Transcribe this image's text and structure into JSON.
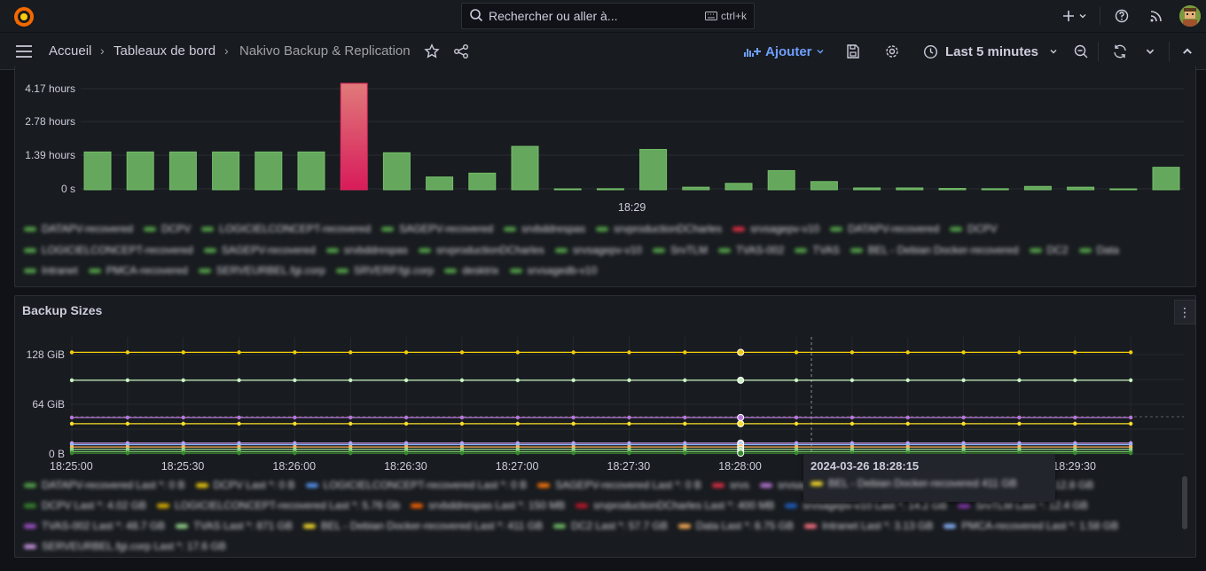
{
  "topbar": {
    "search_placeholder": "Rechercher ou aller à...",
    "search_shortcut": "ctrl+k"
  },
  "breadcrumb": {
    "home": "Accueil",
    "dashboards": "Tableaux de bord",
    "current": "Nakivo Backup & Replication"
  },
  "toolbar": {
    "add_label": "Ajouter",
    "time_range": "Last 5 minutes"
  },
  "panel1": {
    "y_ticks": [
      "4.17 hours",
      "2.78 hours",
      "1.39 hours",
      "0 s"
    ],
    "x_label": "18:29",
    "legend": [
      {
        "name": "DATAPV-recovered",
        "color": "#56a64b"
      },
      {
        "name": "DCPV",
        "color": "#56a64b"
      },
      {
        "name": "LOGICIELCONCEPT-recovered",
        "color": "#56a64b"
      },
      {
        "name": "SAGEPV-recovered",
        "color": "#56a64b"
      },
      {
        "name": "srvbddrespas",
        "color": "#56a64b"
      },
      {
        "name": "srvproductionDCharles",
        "color": "#56a64b"
      },
      {
        "name": "srvsagepv-v10",
        "color": "#e02f44"
      },
      {
        "name": "DATAPV-recovered",
        "color": "#56a64b"
      },
      {
        "name": "DCPV",
        "color": "#56a64b"
      },
      {
        "name": "LOGICIELCONCEPT-recovered",
        "color": "#56a64b"
      },
      {
        "name": "SAGEPV-recovered",
        "color": "#56a64b"
      },
      {
        "name": "srvbddrespas",
        "color": "#56a64b"
      },
      {
        "name": "srvproductionDCharles",
        "color": "#56a64b"
      },
      {
        "name": "srvsagepv-v10",
        "color": "#56a64b"
      },
      {
        "name": "SrvTLM",
        "color": "#56a64b"
      },
      {
        "name": "TVAS-002",
        "color": "#56a64b"
      },
      {
        "name": "TVAS",
        "color": "#56a64b"
      },
      {
        "name": "BEL - Debian Docker-recovered",
        "color": "#56a64b"
      },
      {
        "name": "DC2",
        "color": "#56a64b"
      },
      {
        "name": "Data",
        "color": "#56a64b"
      },
      {
        "name": "Intranet",
        "color": "#56a64b"
      },
      {
        "name": "PMCA-recovered",
        "color": "#56a64b"
      },
      {
        "name": "SERVEURBEL.fgi.corp",
        "color": "#56a64b"
      },
      {
        "name": "SRVERP.fgi.corp",
        "color": "#56a64b"
      },
      {
        "name": "desktrix",
        "color": "#56a64b"
      },
      {
        "name": "srvsagedb-v10",
        "color": "#56a64b"
      }
    ]
  },
  "panel2": {
    "title": "Backup Sizes",
    "y_ticks": [
      "128 GiB",
      "64 GiB",
      "0 B"
    ],
    "x_ticks": [
      "18:25:00",
      "18:25:30",
      "18:26:00",
      "18:26:30",
      "18:27:00",
      "18:27:30",
      "18:28:00",
      "18:28:30",
      "18:29:00",
      "18:29:30"
    ],
    "tooltip_time": "2024-03-26 18:28:15",
    "legend": [
      {
        "name": "DATAPV-recovered  Last *: 0 B",
        "color": "#56a64b"
      },
      {
        "name": "DCPV  Last *: 0 B",
        "color": "#f2cc0c"
      },
      {
        "name": "LOGICIELCONCEPT-recovered  Last *: 0 B",
        "color": "#5794f2"
      },
      {
        "name": "SAGEPV-recovered  Last *: 0 B",
        "color": "#ff780a"
      },
      {
        "name": "srvs",
        "color": "#e02f44"
      },
      {
        "name": "srvsagepv-v10  Last *: 0 B",
        "color": "#b877d9"
      },
      {
        "name": "DATAPV-recovered  Last *: 12.8 GB",
        "color": "#8f3bb8"
      },
      {
        "name": "DCPV  Last *: 4.02 GB",
        "color": "#37872d"
      },
      {
        "name": "LOGICIELCONCEPT-recovered  Last *: 5.76 Gb",
        "color": "#e0b400"
      },
      {
        "name": "srvbddrespas  Last *: 150 MB",
        "color": "#fa6400"
      },
      {
        "name": "srvproductionDCharles  Last *: 400 MB",
        "color": "#c4162a"
      },
      {
        "name": "srvsagepv-v10  Last *: 14.2 GB",
        "color": "#1f60c4"
      },
      {
        "name": "SrvTLM  Last *: 12.4 GB",
        "color": "#8f3bb8"
      },
      {
        "name": "TVAS-002  Last *: 48.7 GB",
        "color": "#a352cc"
      },
      {
        "name": "TVAS  Last *: 871 GB",
        "color": "#96d98d"
      },
      {
        "name": "BEL - Debian Docker-recovered  Last *: 411 GB",
        "color": "#fade2a"
      },
      {
        "name": "DC2  Last *: 57.7 GB",
        "color": "#73bf69"
      },
      {
        "name": "Data  Last *: 8.75 GB",
        "color": "#ffb357"
      },
      {
        "name": "Intranet  Last *: 3.13 GB",
        "color": "#ff7383"
      },
      {
        "name": "PMCA-recovered  Last *: 1.58 GB",
        "color": "#8ab8ff"
      },
      {
        "name": "SERVEURBEL.fgi.corp  Last *: 17.6 GB",
        "color": "#ca95e5"
      }
    ],
    "tooltip_row": "BEL - Debian Docker-recovered   411 GB"
  },
  "chart_data": [
    {
      "type": "bar",
      "title": "",
      "ylabel": "",
      "ylim_hours": [
        0,
        4.17
      ],
      "x_tick": "18:29",
      "values_hours": [
        1.48,
        1.48,
        1.48,
        1.48,
        1.48,
        1.48,
        4.17,
        1.45,
        0.5,
        0.65,
        1.7,
        0.03,
        0.04,
        1.58,
        0.1,
        0.25,
        0.75,
        0.32,
        0.07,
        0.07,
        0.05,
        0.04,
        0.13,
        0.1,
        0.03,
        0.88
      ],
      "colors": [
        "#73bf69",
        "#73bf69",
        "#73bf69",
        "#73bf69",
        "#73bf69",
        "#73bf69",
        "#e0285c",
        "#73bf69",
        "#73bf69",
        "#73bf69",
        "#73bf69",
        "#73bf69",
        "#73bf69",
        "#73bf69",
        "#73bf69",
        "#73bf69",
        "#73bf69",
        "#73bf69",
        "#73bf69",
        "#73bf69",
        "#73bf69",
        "#73bf69",
        "#73bf69",
        "#73bf69",
        "#73bf69",
        "#73bf69"
      ]
    },
    {
      "type": "line",
      "title": "Backup Sizes",
      "ylim_gib": [
        0,
        128
      ],
      "x": [
        "18:25:00",
        "18:25:15",
        "18:25:30",
        "18:25:45",
        "18:26:00",
        "18:26:15",
        "18:26:30",
        "18:26:45",
        "18:27:00",
        "18:27:15",
        "18:27:30",
        "18:27:45",
        "18:28:00",
        "18:28:15",
        "18:28:30",
        "18:28:45",
        "18:29:00",
        "18:29:15",
        "18:29:30",
        "18:29:45"
      ],
      "series": [
        {
          "value_gib": 131,
          "color": "#f2cc0c"
        },
        {
          "value_gib": 95,
          "color": "#c8f2c2"
        },
        {
          "value_gib": 47,
          "color": "#b877d9"
        },
        {
          "value_gib": 39,
          "color": "#fade2a"
        },
        {
          "value_gib": 14,
          "color": "#ca95e5"
        },
        {
          "value_gib": 12,
          "color": "#8ab8ff"
        },
        {
          "value_gib": 9,
          "color": "#ffb357"
        },
        {
          "value_gib": 6,
          "color": "#96d98d"
        },
        {
          "value_gib": 3,
          "color": "#73bf69"
        },
        {
          "value_gib": 1,
          "color": "#37872d"
        }
      ],
      "hover_x": "18:28:15"
    }
  ]
}
